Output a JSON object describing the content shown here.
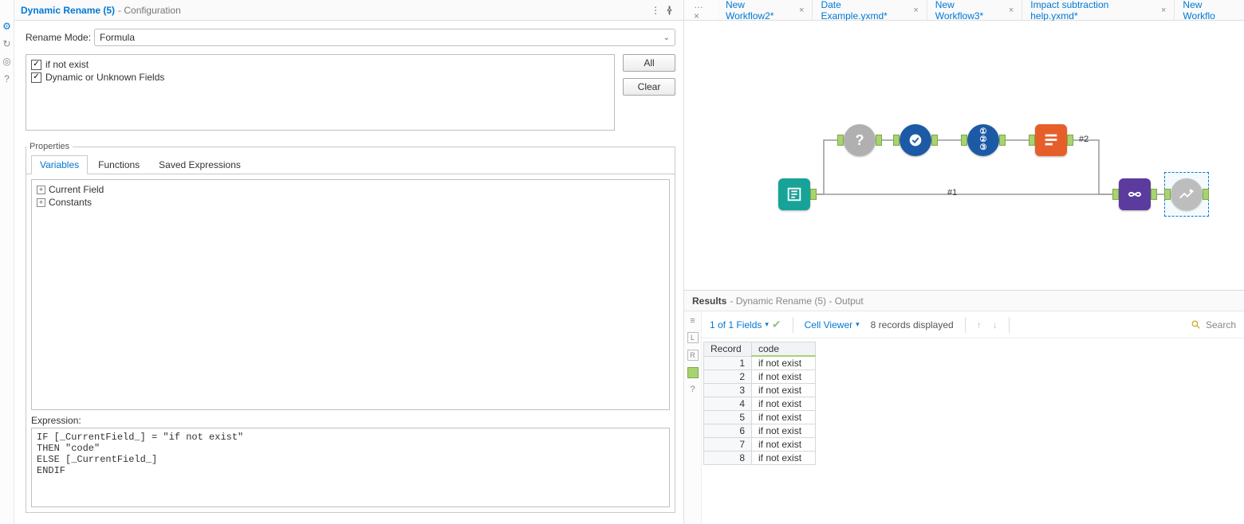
{
  "config": {
    "title": "Dynamic Rename (5)",
    "title_suffix": " - Configuration",
    "mode_label": "Rename Mode:",
    "mode_value": "Formula",
    "check1": "if not exist",
    "check2": "Dynamic or Unknown Fields",
    "btn_all": "All",
    "btn_clear": "Clear",
    "props_legend": "Properties",
    "tabs": {
      "variables": "Variables",
      "functions": "Functions",
      "saved": "Saved Expressions"
    },
    "tree": {
      "current_field": "Current Field",
      "constants": "Constants"
    },
    "expr_label": "Expression:",
    "expr_code": "IF [_CurrentField_] = \"if not exist\"\nTHEN \"code\"\nELSE [_CurrentField_]\nENDIF"
  },
  "workflow_tabs": [
    "New Workflow2*",
    "Date Example.yxmd*",
    "New Workflow3*",
    "Impact subtraction help.yxmd*",
    "New Workflo"
  ],
  "canvas_labels": {
    "c1": "#1",
    "c2": "#2"
  },
  "results": {
    "title": "Results",
    "suffix": " - Dynamic Rename (5) - Output",
    "fields_summary": "1 of 1 Fields",
    "cell_viewer": "Cell Viewer",
    "records_disp": "8 records displayed",
    "search": "Search",
    "columns": {
      "record": "Record",
      "code": "code"
    },
    "rows": [
      {
        "n": "1",
        "v": "if not exist"
      },
      {
        "n": "2",
        "v": "if not exist"
      },
      {
        "n": "3",
        "v": "if not exist"
      },
      {
        "n": "4",
        "v": "if not exist"
      },
      {
        "n": "5",
        "v": "if not exist"
      },
      {
        "n": "6",
        "v": "if not exist"
      },
      {
        "n": "7",
        "v": "if not exist"
      },
      {
        "n": "8",
        "v": "if not exist"
      }
    ]
  }
}
